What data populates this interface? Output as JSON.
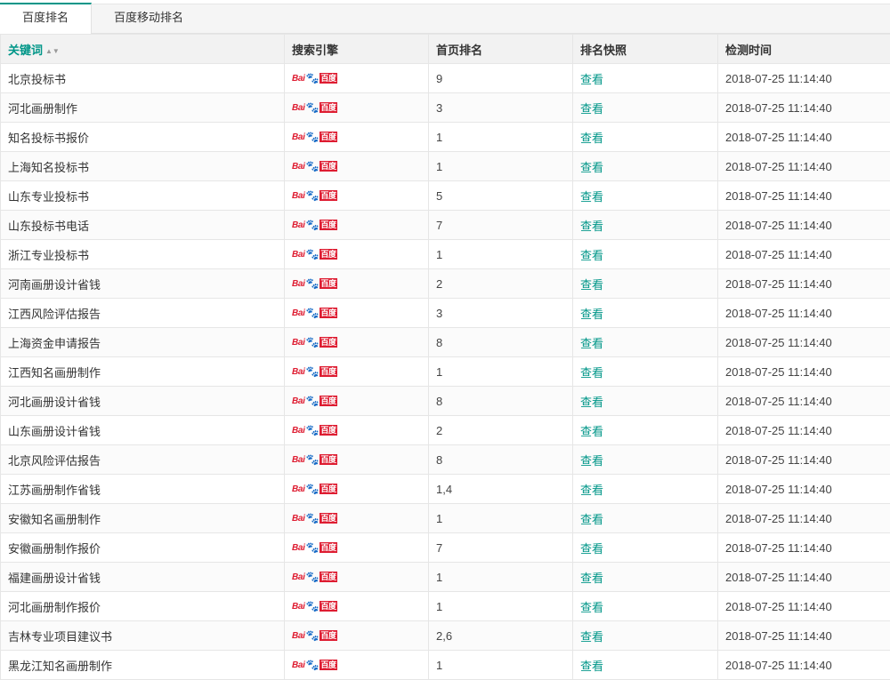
{
  "tabs": [
    {
      "label": "百度排名",
      "active": true
    },
    {
      "label": "百度移动排名",
      "active": false
    }
  ],
  "headers": {
    "keyword": "关键词",
    "engine": "搜索引擎",
    "rank": "首页排名",
    "snapshot": "排名快照",
    "time": "检测时间"
  },
  "engine_logo": {
    "prefix": "Bai",
    "paw": "🐾",
    "suffix": "百度"
  },
  "snapshot_label": "查看",
  "colors": {
    "accent": "#009688",
    "baidu_red": "#de1c31",
    "baidu_blue": "#2932e1"
  },
  "rows": [
    {
      "keyword": "北京投标书",
      "rank": "9",
      "time": "2018-07-25 11:14:40"
    },
    {
      "keyword": "河北画册制作",
      "rank": "3",
      "time": "2018-07-25 11:14:40"
    },
    {
      "keyword": "知名投标书报价",
      "rank": "1",
      "time": "2018-07-25 11:14:40"
    },
    {
      "keyword": "上海知名投标书",
      "rank": "1",
      "time": "2018-07-25 11:14:40"
    },
    {
      "keyword": "山东专业投标书",
      "rank": "5",
      "time": "2018-07-25 11:14:40"
    },
    {
      "keyword": "山东投标书电话",
      "rank": "7",
      "time": "2018-07-25 11:14:40"
    },
    {
      "keyword": "浙江专业投标书",
      "rank": "1",
      "time": "2018-07-25 11:14:40"
    },
    {
      "keyword": "河南画册设计省钱",
      "rank": "2",
      "time": "2018-07-25 11:14:40"
    },
    {
      "keyword": "江西风险评估报告",
      "rank": "3",
      "time": "2018-07-25 11:14:40"
    },
    {
      "keyword": "上海资金申请报告",
      "rank": "8",
      "time": "2018-07-25 11:14:40"
    },
    {
      "keyword": "江西知名画册制作",
      "rank": "1",
      "time": "2018-07-25 11:14:40"
    },
    {
      "keyword": "河北画册设计省钱",
      "rank": "8",
      "time": "2018-07-25 11:14:40"
    },
    {
      "keyword": "山东画册设计省钱",
      "rank": "2",
      "time": "2018-07-25 11:14:40"
    },
    {
      "keyword": "北京风险评估报告",
      "rank": "8",
      "time": "2018-07-25 11:14:40"
    },
    {
      "keyword": "江苏画册制作省钱",
      "rank": "1,4",
      "time": "2018-07-25 11:14:40"
    },
    {
      "keyword": "安徽知名画册制作",
      "rank": "1",
      "time": "2018-07-25 11:14:40"
    },
    {
      "keyword": "安徽画册制作报价",
      "rank": "7",
      "time": "2018-07-25 11:14:40"
    },
    {
      "keyword": "福建画册设计省钱",
      "rank": "1",
      "time": "2018-07-25 11:14:40"
    },
    {
      "keyword": "河北画册制作报价",
      "rank": "1",
      "time": "2018-07-25 11:14:40"
    },
    {
      "keyword": "吉林专业项目建议书",
      "rank": "2,6",
      "time": "2018-07-25 11:14:40"
    },
    {
      "keyword": "黑龙江知名画册制作",
      "rank": "1",
      "time": "2018-07-25 11:14:40"
    }
  ]
}
